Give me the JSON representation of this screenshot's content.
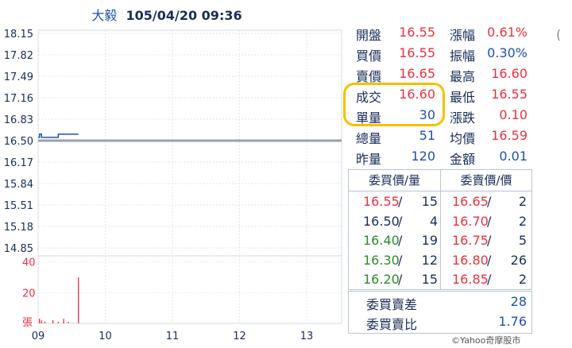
{
  "header": {
    "stock_name": "大毅",
    "datetime": "105/04/20 09:36"
  },
  "chart_data": {
    "type": "line",
    "price_axis": {
      "ticks": [
        "18.15",
        "17.82",
        "17.49",
        "17.16",
        "16.83",
        "16.50",
        "16.17",
        "15.84",
        "15.51",
        "15.18",
        "14.85"
      ],
      "ylim": [
        14.85,
        18.15
      ],
      "reference": 16.5
    },
    "volume_axis": {
      "ticks": [
        "40",
        "20"
      ],
      "ylim": [
        0,
        45
      ],
      "unit_label": "張"
    },
    "time_axis": {
      "ticks": [
        "09",
        "10",
        "11",
        "12",
        "13"
      ]
    },
    "series": [
      {
        "x": [
          9.0,
          9.02,
          9.05,
          9.08,
          9.15,
          9.25,
          9.3,
          9.35,
          9.45,
          9.55,
          9.6
        ],
        "values": [
          16.55,
          16.6,
          16.55,
          16.55,
          16.55,
          16.55,
          16.6,
          16.6,
          16.6,
          16.6,
          16.6
        ]
      }
    ],
    "volume": {
      "x": [
        9.02,
        9.05,
        9.1,
        9.22,
        9.3,
        9.38,
        9.45,
        9.6
      ],
      "values": [
        3,
        2,
        1,
        2,
        1,
        3,
        1,
        30
      ]
    }
  },
  "stats": [
    {
      "label1": "開盤",
      "value1": "16.55",
      "color1": "red",
      "label2": "漲幅",
      "value2": "0.61%",
      "color2": "red"
    },
    {
      "label1": "買價",
      "value1": "16.55",
      "color1": "red",
      "label2": "振幅",
      "value2": "0.30%",
      "color2": "blue"
    },
    {
      "label1": "賣價",
      "value1": "16.65",
      "color1": "red",
      "label2": "最高",
      "value2": "16.60",
      "color2": "red"
    },
    {
      "label1": "成交",
      "value1": "16.60",
      "color1": "red",
      "label2": "最低",
      "value2": "16.55",
      "color2": "red"
    },
    {
      "label1": "單量",
      "value1": "30",
      "color1": "blue",
      "label2": "漲跌",
      "value2": "0.10",
      "color2": "red"
    },
    {
      "label1": "總量",
      "value1": "51",
      "color1": "blue",
      "label2": "均價",
      "value2": "16.59",
      "color2": "red"
    },
    {
      "label1": "昨量",
      "value1": "120",
      "color1": "blue",
      "label2": "金額",
      "value2": "0.01",
      "color2": "blue"
    }
  ],
  "order_book": {
    "bid_header": "委買價/量",
    "ask_header": "委賣價/價",
    "rows": [
      {
        "bid_price": "16.55",
        "bid_color": "red",
        "bid_qty": "15",
        "ask_price": "16.65",
        "ask_color": "red",
        "ask_qty": "2"
      },
      {
        "bid_price": "16.50",
        "bid_color": "dark",
        "bid_qty": "4",
        "ask_price": "16.70",
        "ask_color": "red",
        "ask_qty": "2"
      },
      {
        "bid_price": "16.40",
        "bid_color": "green",
        "bid_qty": "19",
        "ask_price": "16.75",
        "ask_color": "red",
        "ask_qty": "5"
      },
      {
        "bid_price": "16.30",
        "bid_color": "green",
        "bid_qty": "12",
        "ask_price": "16.80",
        "ask_color": "red",
        "ask_qty": "26"
      },
      {
        "bid_price": "16.20",
        "bid_color": "green",
        "bid_qty": "15",
        "ask_price": "16.85",
        "ask_color": "red",
        "ask_qty": "2"
      }
    ]
  },
  "summary": [
    {
      "label": "委買賣差",
      "value": "28"
    },
    {
      "label": "委買賣比",
      "value": "1.76"
    }
  ],
  "copyright": "©Yahoo奇摩股市",
  "edge_glyph": "(",
  "colors": {
    "red": "#e8323c",
    "blue": "#1e50b4",
    "green": "#2a8a2a",
    "dark": "#1a2d5a",
    "highlight": "#f5c000",
    "reference_line": "#9aa0a6"
  }
}
